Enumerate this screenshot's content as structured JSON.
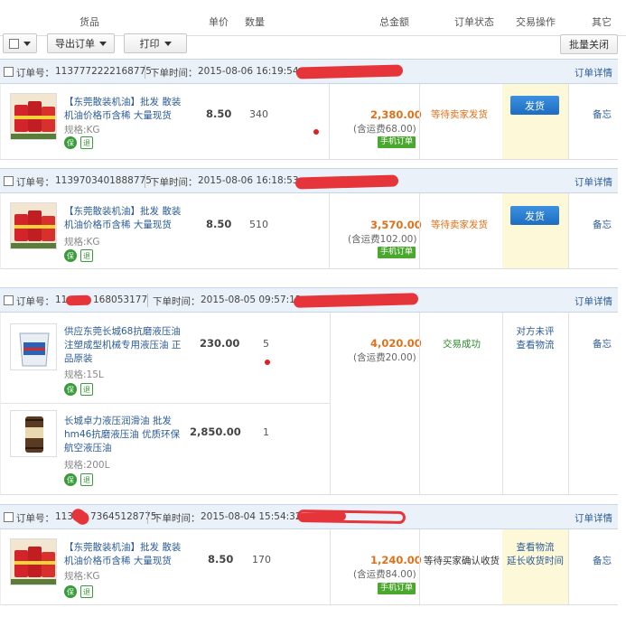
{
  "columns": {
    "goods": "货品",
    "unit_price": "单价",
    "quantity": "数量",
    "total": "总金额",
    "order_status": "订单状态",
    "trade_action": "交易操作",
    "other": "其它"
  },
  "toolbar": {
    "export": "导出订单",
    "print": "打印",
    "batch_close": "批量关闭"
  },
  "common": {
    "order_no_label": "订单号：",
    "order_time_label": "下单时间：",
    "order_detail": "订单详情",
    "memo": "备忘",
    "shipping_open": "(含运费",
    "mobile_order": "手机订单",
    "badge_bao": "保",
    "badge_tui": "退"
  },
  "orders": [
    {
      "order_no": "1137772222168775",
      "order_time": "2015-08-06 16:19:54",
      "total": "2,380.00",
      "shipping": "68.00)",
      "status": "等待卖家发货",
      "action": "发货",
      "items": [
        {
          "name": "【东莞散装机油】批发 散装机油价格币含稀 大量现货",
          "spec": "规格:KG",
          "price": "8.50",
          "qty": "340"
        }
      ]
    },
    {
      "order_no": "1139703401888775",
      "order_time": "2015-08-06 16:18:53",
      "total": "3,570.00",
      "shipping": "102.00)",
      "status": "等待卖家发货",
      "action": "发货",
      "items": [
        {
          "name": "【东莞散装机油】批发 散装机油价格币含稀 大量现货",
          "spec": "规格:KG",
          "price": "8.50",
          "qty": "510"
        }
      ]
    },
    {
      "order_no": "11",
      "order_no_tail": "168053177",
      "order_time": "2015-08-05 09:57:12",
      "total": "4,020.00",
      "shipping": "20.00)",
      "status": "交易成功",
      "action1": "对方未评",
      "action2": "查看物流",
      "items": [
        {
          "name": "供应东莞长城68抗磨液压油 注塑成型机械专用液压油 正品原装",
          "spec": "规格:15L",
          "price": "230.00",
          "qty": "5"
        },
        {
          "name": "长城卓力液压润滑油 批发hm46抗磨液压油 优质环保航空液压油",
          "spec": "规格:200L",
          "price": "2,850.00",
          "qty": "1"
        }
      ]
    },
    {
      "order_no": "113",
      "order_no_tail": "73645128775",
      "order_time": "2015-08-04 15:54:32",
      "total": "1,240.00",
      "shipping": "84.00)",
      "status": "等待买家确认收货",
      "action1": "查看物流",
      "action2": "延长收货时间",
      "items": [
        {
          "name": "【东莞散装机油】批发 散装机油价格币含稀 大量现货",
          "spec": "规格:KG",
          "price": "8.50",
          "qty": "170"
        }
      ]
    }
  ],
  "colors": {
    "status_waiting": "#e0701a",
    "status_success": "#2a8a2a",
    "total_amount": "#e0701a",
    "action_bg": "#fdf8d8",
    "ship_button": "#1d6dc2"
  }
}
